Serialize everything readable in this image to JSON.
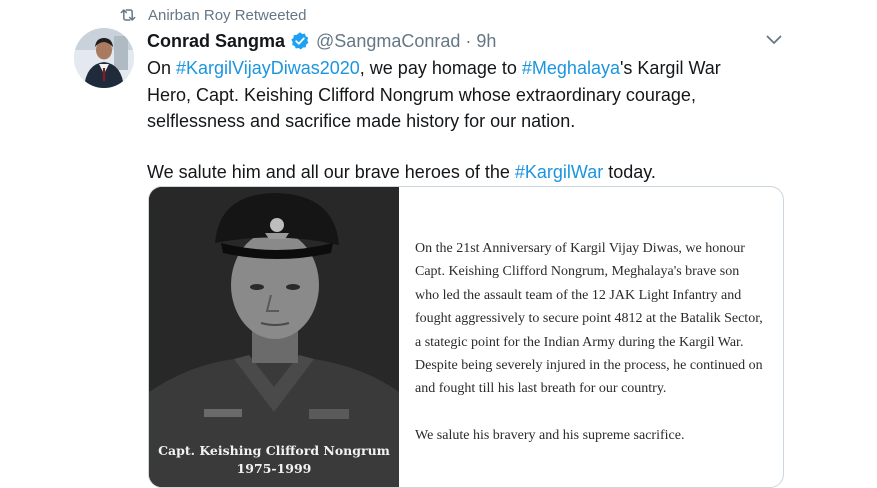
{
  "retweet": {
    "icon": "retweet-icon",
    "label": "Anirban Roy Retweeted"
  },
  "author": {
    "name": "Conrad Sangma",
    "handle": "@SangmaConrad",
    "separator": "·",
    "time": "9h",
    "verified_icon": "verified-badge-icon",
    "avatar": "profile-photo"
  },
  "tweet": {
    "line1": {
      "t1": "On ",
      "tag1": "#KargilVijayDiwas2020",
      "t2": ", we pay homage to ",
      "tag2": "#Meghalaya",
      "t3": "'s Kargil War Hero, Capt. Keishing Clifford Nongrum whose extraordinary courage, selflessness and sacrifice made history for our nation."
    },
    "line2": {
      "t1": "We salute him and all our brave heroes of the ",
      "tag1": "#KargilWar",
      "t2": " today."
    }
  },
  "media": {
    "caption_name": "Capt. Keishing Clifford Nongrum",
    "caption_years": "1975-1999",
    "paragraph1": "On the 21st Anniversary of Kargil Vijay Diwas, we honour Capt. Keishing Clifford Nongrum, Meghalaya's brave son who led the assault team of the 12 JAK Light Infantry and fought  aggressively to secure point 4812  at the Batalik Sector, a stategic point for the Indian Army during the Kargil War. Despite being severely injured in the process, he continued on and fought till his last breath for our country.",
    "paragraph2": "We salute his bravery and his supreme sacrifice."
  },
  "colors": {
    "link": "#1b95e0",
    "muted": "#657786",
    "text": "#14171a",
    "border": "#ccd6dd"
  }
}
